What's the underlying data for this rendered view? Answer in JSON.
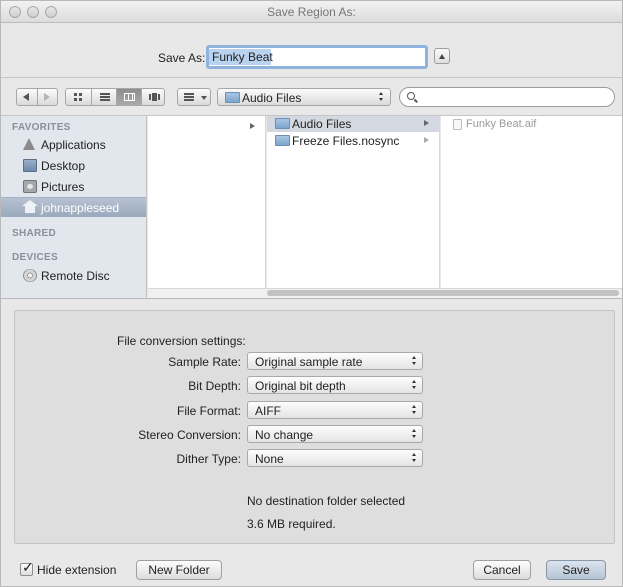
{
  "window": {
    "title": "Save Region As:"
  },
  "save_as": {
    "label": "Save As:",
    "value": "Funky Beat"
  },
  "toolbar": {
    "location": "Audio Files",
    "search_value": ""
  },
  "sidebar": {
    "sections": [
      {
        "heading": "FAVORITES"
      },
      {
        "heading": "SHARED"
      },
      {
        "heading": "DEVICES"
      }
    ],
    "items": [
      {
        "label": "Applications",
        "icon": "applications-icon",
        "selected": false
      },
      {
        "label": "Desktop",
        "icon": "desktop-icon",
        "selected": false
      },
      {
        "label": "Pictures",
        "icon": "pictures-icon",
        "selected": false
      },
      {
        "label": "johnappleseed",
        "icon": "home-icon",
        "selected": true
      },
      {
        "label": "Remote Disc",
        "icon": "remote-disc-icon",
        "selected": false
      }
    ]
  },
  "browser": {
    "column2": [
      {
        "label": "Audio Files",
        "selected": true
      },
      {
        "label": "Freeze Files.nosync",
        "selected": false
      }
    ],
    "column3": [
      {
        "label": "Funky Beat.aif",
        "dimmed": true
      }
    ]
  },
  "conversion": {
    "title": "File conversion settings:",
    "fields": [
      {
        "label": "Sample Rate:",
        "value": "Original sample rate"
      },
      {
        "label": "Bit Depth:",
        "value": "Original bit depth"
      },
      {
        "label": "File Format:",
        "value": "AIFF"
      },
      {
        "label": "Stereo Conversion:",
        "value": "No change"
      },
      {
        "label": "Dither Type:",
        "value": "None"
      }
    ],
    "status_line1": "No destination folder selected",
    "status_line2": "3.6 MB required."
  },
  "bottom": {
    "hide_extension_label": "Hide extension",
    "hide_extension_checked": true,
    "new_folder_label": "New Folder",
    "cancel_label": "Cancel",
    "save_label": "Save"
  },
  "colors": {
    "selection_blue": "#9aa9bd",
    "default_button": "#b6c4d4"
  }
}
